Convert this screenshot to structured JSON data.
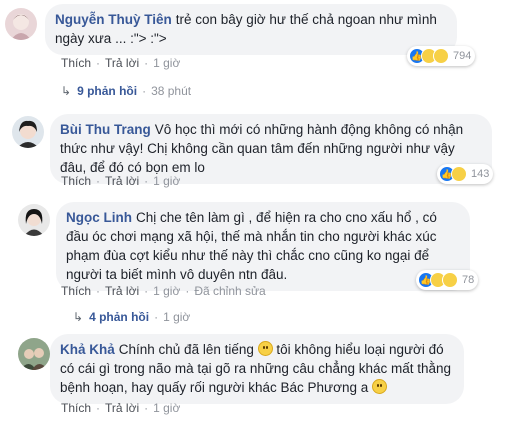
{
  "comments": [
    {
      "name": "Nguyễn Thuỳ Tiên",
      "text": "trẻ con bây giờ hư thế chả ngoan như mình ngày xưa ... :\"> :\">",
      "actions": {
        "like": "Thích",
        "reply": "Trả lời",
        "time": "1 giờ"
      },
      "reactions": {
        "icons": [
          "like-icon",
          "haha-icon",
          "wow-icon"
        ],
        "count": "794"
      },
      "replies": {
        "label": "9 phản hồi",
        "time": "38 phút"
      }
    },
    {
      "name": "Bùi Thu Trang",
      "text": "Vô học thì mới có những hành động không có nhận thức như vậy! Chị không cần quan tâm đến những người như vậy đâu, để đó có bọn em lo",
      "actions": {
        "like": "Thích",
        "reply": "Trả lời",
        "time": "1 giờ"
      },
      "reactions": {
        "icons": [
          "like-icon",
          "haha-icon"
        ],
        "count": "143"
      }
    },
    {
      "name": "Ngọc Linh",
      "text": "Chị che tên làm gì , để hiện ra cho cno xấu hổ , có đầu óc chơi mạng xã hội, thế mà nhắn tin cho người khác xúc phạm đùa cợt kiểu như thế này thì chắc cno cũng ko ngại để người ta biết mình vô duyên ntn đâu.",
      "actions": {
        "like": "Thích",
        "reply": "Trả lời",
        "time": "1 giờ",
        "edited": "Đã chỉnh sửa"
      },
      "reactions": {
        "icons": [
          "like-icon",
          "haha-icon",
          "sad-icon"
        ],
        "count": "78"
      },
      "replies": {
        "label": "4 phản hồi",
        "time": "1 giờ"
      }
    },
    {
      "name": "Khả Khả",
      "text_parts": [
        "Chính chủ đã lên tiếng",
        "tôi không hiểu loại người đó có cái gì trong não mà tại gõ ra những câu chẳng khác mất thằng bệnh hoạn, hay quấy rối người khác Bác Phương a"
      ],
      "emoji": "smile-emoji",
      "actions": {
        "like": "Thích",
        "reply": "Trả lời",
        "time": "1 giờ"
      }
    }
  ],
  "colors": {
    "name": "#385898",
    "bubble": "#f2f3f5",
    "like": "#1877f2",
    "meta": "#90949c"
  }
}
